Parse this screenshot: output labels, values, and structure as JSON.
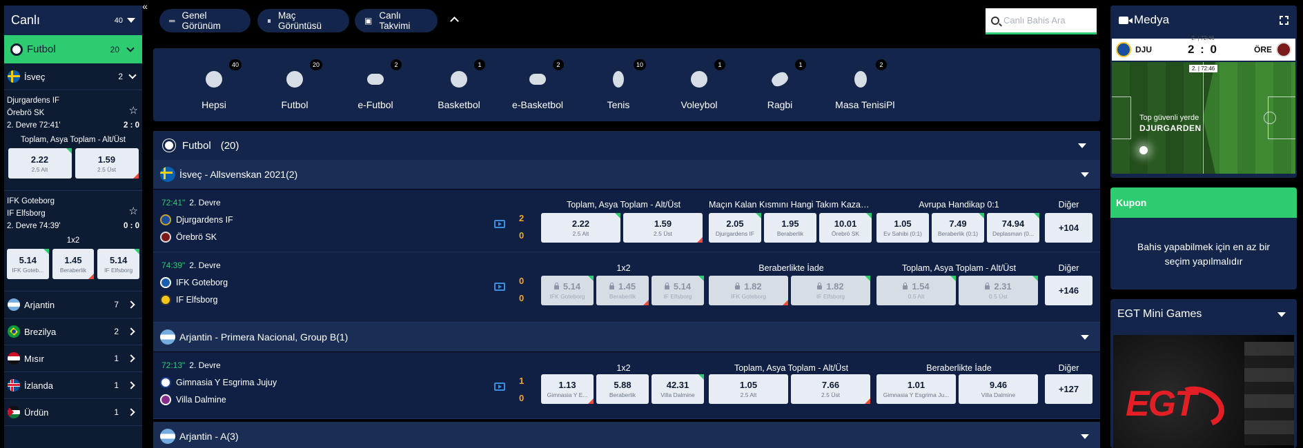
{
  "sidebar": {
    "title": "Canlı",
    "count": "40",
    "collapse_icon": "«",
    "sport": {
      "name": "Futbol",
      "count": "20"
    },
    "country_open": {
      "name": "İsveç",
      "count": "2"
    },
    "matches": [
      {
        "home": "Djurgardens IF",
        "away": "Örebrö SK",
        "time": "2. Devre 72:41'",
        "score": "2 : 0",
        "market": "Toplam, Asya Toplam - Alt/Üst",
        "odds": [
          {
            "v": "2.22",
            "l": "2.5 Alt"
          },
          {
            "v": "1.59",
            "l": "2.5 Üst"
          }
        ]
      },
      {
        "home": "IFK Goteborg",
        "away": "IF Elfsborg",
        "time": "2. Devre 74:39'",
        "score": "0 : 0",
        "market": "1x2",
        "odds": [
          {
            "v": "5.14",
            "l": "IFK Goteb..."
          },
          {
            "v": "1.45",
            "l": "Beraberlik"
          },
          {
            "v": "5.14",
            "l": "IF Elfsborg"
          }
        ]
      }
    ],
    "countries": [
      {
        "name": "Arjantin",
        "count": "7"
      },
      {
        "name": "Brezilya",
        "count": "2"
      },
      {
        "name": "Mısır",
        "count": "1"
      },
      {
        "name": "İzlanda",
        "count": "1"
      },
      {
        "name": "Ürdün",
        "count": "1"
      }
    ]
  },
  "toolbar": {
    "general_view": "Genel Görünüm",
    "match_view": "Maç Görüntüsü",
    "live_calendar": "Canlı Takvimi",
    "search_placeholder": "Canlı Bahis Ara"
  },
  "sports": [
    {
      "name": "Hepsi",
      "count": "40"
    },
    {
      "name": "Futbol",
      "count": "20"
    },
    {
      "name": "e-Futbol",
      "count": "2"
    },
    {
      "name": "Basketbol",
      "count": "1"
    },
    {
      "name": "e-Basketbol",
      "count": "2"
    },
    {
      "name": "Tenis",
      "count": "10"
    },
    {
      "name": "Voleybol",
      "count": "1"
    },
    {
      "name": "Ragbi",
      "count": "1"
    },
    {
      "name": "Masa Tenisi",
      "count": "2"
    },
    {
      "name": "Pl",
      "count": ""
    }
  ],
  "main": {
    "section": {
      "name": "Futbol",
      "count": "(20)"
    },
    "leagues": [
      {
        "name": "İsveç - Allsvenskan 2021(2)"
      },
      {
        "name": "Arjantin - Primera Nacional, Group B(1)"
      },
      {
        "name": "Arjantin - A(3)"
      }
    ],
    "events": [
      {
        "minute": "72:41\"",
        "period": "2. Devre",
        "home": "Djurgardens IF",
        "away": "Örebrö SK",
        "home_score": "2",
        "away_score": "0",
        "m1": "Toplam, Asya Toplam - Alt/Üst",
        "m2": "Maçın Kalan Kısmını Hangi Takım Kazanı...",
        "m3": "Avrupa Handikap 0:1",
        "other": "Diğer",
        "more": "+104",
        "o1": [
          {
            "v": "2.22",
            "l": "2.5 Alt"
          },
          {
            "v": "1.59",
            "l": "2.5 Üst"
          }
        ],
        "o2": [
          {
            "v": "2.05",
            "l": "Djurgardens IF"
          },
          {
            "v": "1.95",
            "l": "Beraberlik"
          },
          {
            "v": "10.01",
            "l": "Örebrö SK"
          }
        ],
        "o3": [
          {
            "v": "1.05",
            "l": "Ev Sahibi (0:1)"
          },
          {
            "v": "7.49",
            "l": "Beraberlik (0:1)"
          },
          {
            "v": "74.94",
            "l": "Deplasman (0..."
          }
        ]
      },
      {
        "minute": "74:39\"",
        "period": "2. Devre",
        "home": "IFK Goteborg",
        "away": "IF Elfsborg",
        "home_score": "0",
        "away_score": "0",
        "m1": "1x2",
        "m2": "Beraberlikte İade",
        "m3": "Toplam, Asya Toplam - Alt/Üst",
        "other": "Diğer",
        "more": "+146",
        "o1": [
          {
            "v": "5.14",
            "l": "IFK Goteborg"
          },
          {
            "v": "1.45",
            "l": "Beraberlik"
          },
          {
            "v": "5.14",
            "l": "IF Elfsborg"
          }
        ],
        "o2": [
          {
            "v": "1.82",
            "l": "IFK Goteborg"
          },
          {
            "v": "1.82",
            "l": "IF Elfsborg"
          }
        ],
        "o3": [
          {
            "v": "1.54",
            "l": "0.5 Alt"
          },
          {
            "v": "2.31",
            "l": "0.5 Üst"
          }
        ]
      },
      {
        "minute": "72:13\"",
        "period": "2. Devre",
        "home": "Gimnasia Y Esgrima Jujuy",
        "away": "Villa Dalmine",
        "home_score": "1",
        "away_score": "0",
        "m1": "1x2",
        "m2": "Toplam, Asya Toplam - Alt/Üst",
        "m3": "Beraberlikte İade",
        "other": "Diğer",
        "more": "+127",
        "o1": [
          {
            "v": "1.13",
            "l": "Gimnasia Y E..."
          },
          {
            "v": "5.88",
            "l": "Beraberlik"
          },
          {
            "v": "42.31",
            "l": "Villa Dalmine"
          }
        ],
        "o2": [
          {
            "v": "1.05",
            "l": "2.5 Alt"
          },
          {
            "v": "7.66",
            "l": "2.5 Üst"
          }
        ],
        "o3": [
          {
            "v": "1.01",
            "l": "Gimnasia Y Esgrima Ju..."
          },
          {
            "v": "9.46",
            "l": "Villa Dalmine"
          }
        ]
      }
    ]
  },
  "media": {
    "title": "Medya",
    "home_abbr": "DJU",
    "away_abbr": "ÖRE",
    "period": "2. | 72:46",
    "score": "2 : 0",
    "pitch_time": "2. | 72:46",
    "pitch_msg": "Top güvenli yerde",
    "pitch_team": "DJURGARDEN"
  },
  "coupon": {
    "title": "Kupon",
    "message": "Bahis yapabilmek için en az bir seçim yapılmalıdır"
  },
  "egt": {
    "title": "EGT Mini Games",
    "logo_text": "EGT"
  },
  "colors": {
    "accent": "#2ecc71",
    "panel": "#13254a",
    "score": "#f5a623",
    "up": "#2ecc71",
    "down": "#e74c3c"
  }
}
